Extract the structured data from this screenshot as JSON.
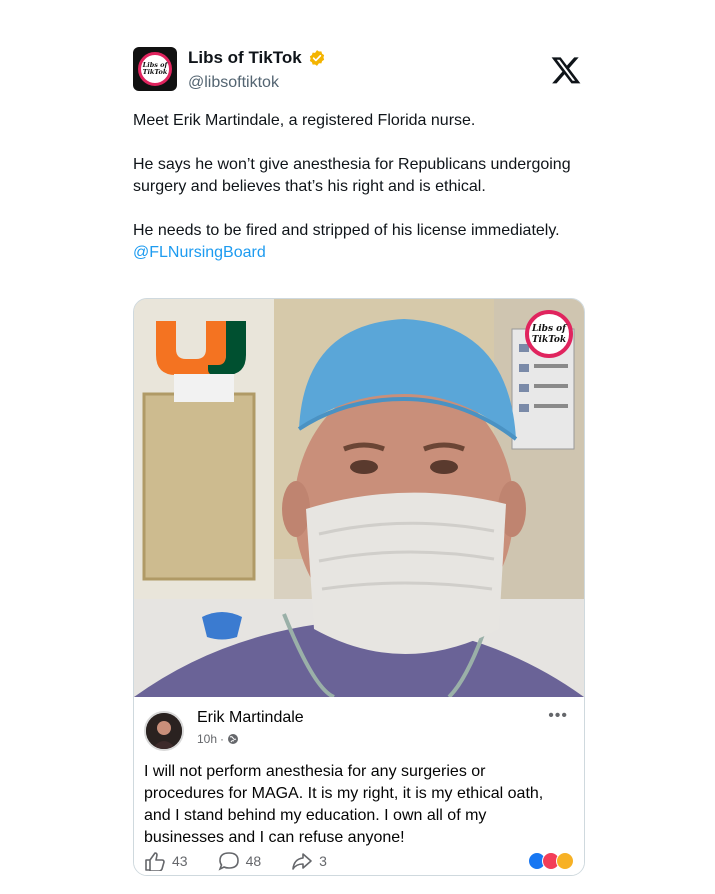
{
  "tweet": {
    "display_name": "Libs of TikTok",
    "handle": "@libsoftiktok",
    "avatar_text": "Libs of TikTok",
    "paragraphs": [
      "Meet Erik Martindale, a registered Florida nurse.",
      "He says he won’t give anesthesia for Republicans undergoing surgery and believes that’s his right and is ethical.",
      "He needs to be fired and stripped of his license immediately."
    ],
    "mention": "@FLNursingBoard"
  },
  "photo": {
    "watermark_text": "Libs of TikTok",
    "logo_letter": "U"
  },
  "fb_post": {
    "author": "Erik Martindale",
    "time": "10h",
    "more_label": "•••",
    "text": "I will not perform anesthesia for any surgeries or procedures for MAGA. It is my right, it is my ethical oath, and I stand behind my education. I own all of my businesses and I can refuse anyone!",
    "likes": "43",
    "comments": "48",
    "shares": "3"
  },
  "colors": {
    "verified": "#f4b400",
    "mention": "#1d9bf0",
    "scrub_cap": "#5aa6d8",
    "fb_like": "#1877f2",
    "fb_love": "#f33e58",
    "fb_haha": "#f7b125"
  }
}
